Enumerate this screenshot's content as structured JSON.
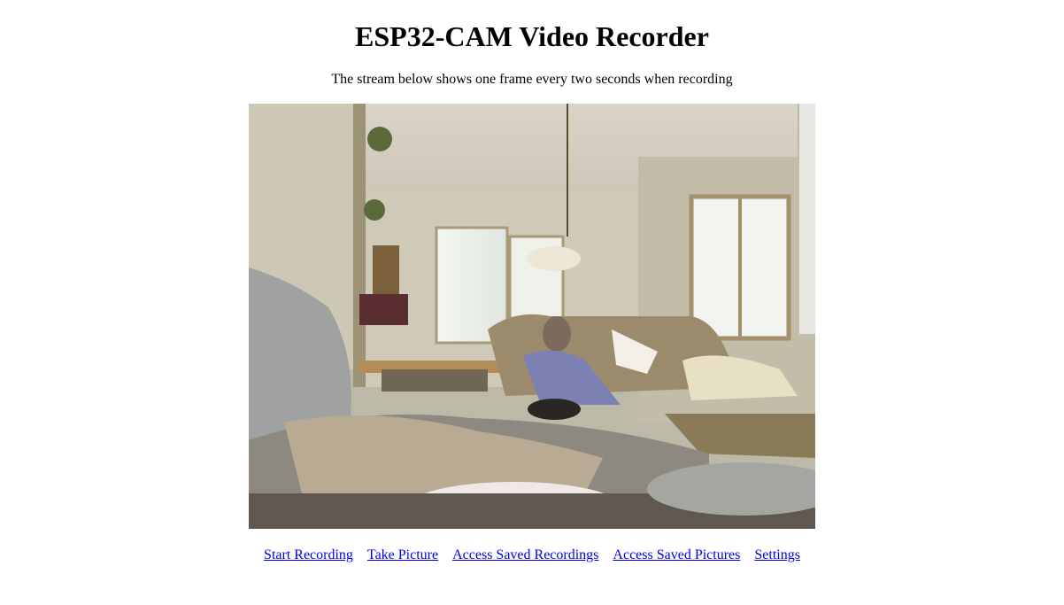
{
  "page": {
    "title": "ESP32-CAM Video Recorder",
    "subtitle": "The stream below shows one frame every two seconds when recording"
  },
  "stream": {
    "icon": "camera-frame"
  },
  "nav": {
    "links": [
      {
        "label": "Start Recording"
      },
      {
        "label": "Take Picture"
      },
      {
        "label": "Access Saved Recordings"
      },
      {
        "label": "Access Saved Pictures"
      },
      {
        "label": "Settings"
      }
    ],
    "link_color": "#0000ee"
  }
}
